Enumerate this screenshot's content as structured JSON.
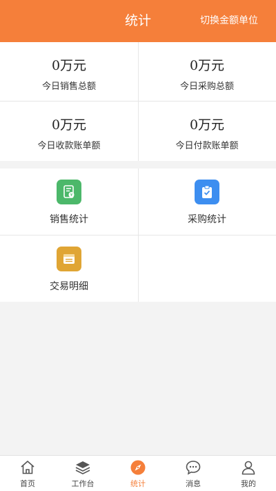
{
  "header": {
    "title": "统计",
    "action_label": "切换金额单位"
  },
  "stats": [
    {
      "value": "0万元",
      "label": "今日销售总额"
    },
    {
      "value": "0万元",
      "label": "今日采购总额"
    },
    {
      "value": "0万元",
      "label": "今日收款账单额"
    },
    {
      "value": "0万元",
      "label": "今日付款账单额"
    }
  ],
  "menu": [
    {
      "label": "销售统计",
      "icon": "sales-report-icon",
      "color": "#4cb86a"
    },
    {
      "label": "采购统计",
      "icon": "clipboard-check-icon",
      "color": "#3d8ef0"
    },
    {
      "label": "交易明细",
      "icon": "transaction-list-icon",
      "color": "#e0a534"
    }
  ],
  "tabbar": {
    "active_color": "#f57f3a",
    "items": [
      {
        "label": "首页",
        "icon": "home-icon"
      },
      {
        "label": "工作台",
        "icon": "layers-icon"
      },
      {
        "label": "统计",
        "icon": "compass-icon"
      },
      {
        "label": "消息",
        "icon": "chat-bubble-icon"
      },
      {
        "label": "我的",
        "icon": "user-icon"
      }
    ]
  }
}
